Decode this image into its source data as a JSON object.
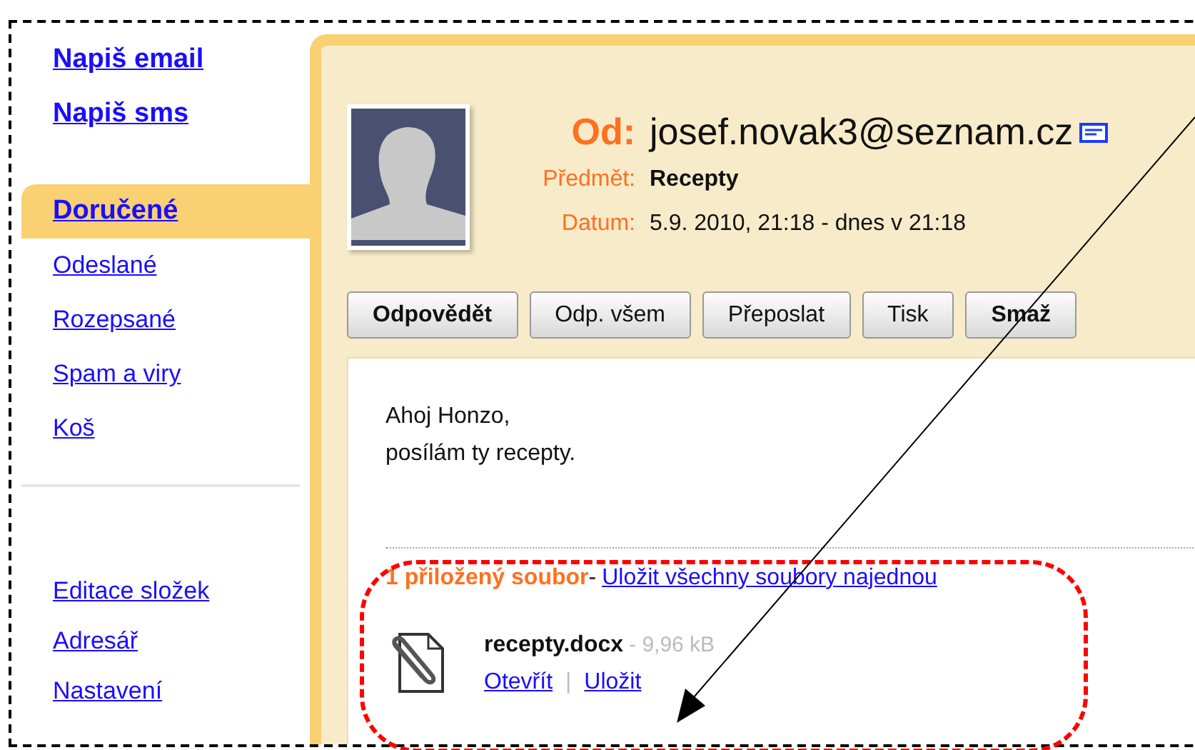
{
  "sidebar": {
    "items": [
      {
        "label": "Napiš email",
        "kind": "compose",
        "selected": false
      },
      {
        "label": "Napiš sms",
        "kind": "compose",
        "selected": false
      },
      {
        "label": "Doručené",
        "kind": "folder",
        "selected": true
      },
      {
        "label": "Odeslané",
        "kind": "folder",
        "selected": false
      },
      {
        "label": "Rozepsané",
        "kind": "folder",
        "selected": false
      },
      {
        "label": "Spam a viry",
        "kind": "folder",
        "selected": false
      },
      {
        "label": "Koš",
        "kind": "folder",
        "selected": false
      },
      {
        "label": "Editace složek",
        "kind": "settings",
        "selected": false
      },
      {
        "label": "Adresář",
        "kind": "settings",
        "selected": false
      },
      {
        "label": "Nastavení",
        "kind": "settings",
        "selected": false
      }
    ]
  },
  "message": {
    "from_label": "Od:",
    "from": "josef.novak3@seznam.cz",
    "subject_label": "Předmět:",
    "subject": "Recepty",
    "date_label": "Datum:",
    "date": "5.9. 2010, 21:18 - dnes v 21:18",
    "buttons": [
      {
        "label": "Odpovědět",
        "kind": "primary"
      },
      {
        "label": "Odp. všem",
        "kind": "normal"
      },
      {
        "label": "Přeposlat",
        "kind": "normal"
      },
      {
        "label": "Tisk",
        "kind": "normal"
      },
      {
        "label": "Smaž",
        "kind": "primary"
      }
    ],
    "body": [
      "Ahoj Honzo,",
      "posílám ty recepty."
    ],
    "attachments_header": "1 přiložený soubor",
    "attachments_separator": "-",
    "save_all": "Uložit všechny soubory najednou",
    "attachments": [
      {
        "name": "recepty.docx",
        "size": "- 9,96 kB",
        "open": "Otevřít",
        "divider": "|",
        "save": "Uložit"
      }
    ]
  }
}
